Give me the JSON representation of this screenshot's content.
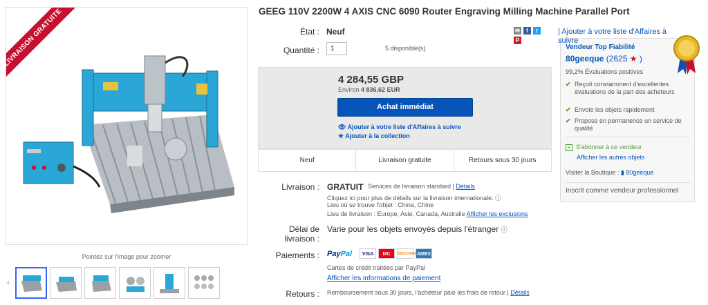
{
  "listing": {
    "title": "GEEG 110V 2200W 4 AXIS CNC 6090 Router Engraving Milling Machine Parallel Port",
    "ribbon": "LIVRAISON GRATUITE",
    "zoom_hint": "Pointez sur l'image pour zoomer",
    "thumb_count": 6
  },
  "item": {
    "condition_label": "État :",
    "condition_value": "Neuf",
    "quantity_label": "Quantité :",
    "quantity_value": "1",
    "available": "5 disponible(s)"
  },
  "price": {
    "amount": "4 284,55 GBP",
    "approx_prefix": "Environ",
    "approx_value": "4 836,62 EUR",
    "buy_label": "Achat immédiat",
    "watch_label": "Ajouter à votre liste d'Affaires à suivre",
    "collection_label": "Ajouter à la collection",
    "strip": [
      "Neuf",
      "Livraison gratuite",
      "Retours sous 30 jours"
    ]
  },
  "shipping": {
    "label": "Livraison :",
    "value": "GRATUIT",
    "service": "Services de livraison standard |",
    "details_link": "Détails",
    "intl_note": "Cliquez ici pour plus de détails sur la livraison internationale.",
    "location": "Lieu où se trouve l'objet : China, Chine",
    "ship_to": "Lieu de livraison : Europe, Asie, Canada, Australie",
    "exclusions_link": "Afficher les exclusions"
  },
  "delivery": {
    "label_1": "Délai de",
    "label_2": "livraison :",
    "value": "Varie pour les objets envoyés depuis l'étranger"
  },
  "payment": {
    "label": "Paiements :",
    "paypal_1": "Pay",
    "paypal_2": "Pal",
    "cards": [
      "VISA",
      "MC",
      "DISCOVER",
      "AMEX"
    ],
    "note": "Cartes de crédit traitées par PayPal",
    "info_link": "Afficher les informations de paiement"
  },
  "returns": {
    "label": "Retours :",
    "value": "Remboursement sous 30 jours, l'acheteur paie les frais de retour |",
    "details_link": "Détails"
  },
  "seller": {
    "wishlist": "| Ajouter à votre liste d'Affaires à suivre",
    "badge_title": "Vendeur Top Fiabilité",
    "name": "80geeque",
    "score": "(2625",
    "score_close": ")",
    "positive": "99,2% Évaluations positives",
    "features": [
      "Reçoit constamment d'excellentes évaluations de la part des acheteurs",
      "Envoie les objets rapidement",
      "Propose en permanence un service de qualité"
    ],
    "follow": "S'abonner à ce vendeur",
    "other_items": "Afficher les autres objets",
    "shop_prefix": "Visiter la Boutique :",
    "shop_name": "80geeque",
    "professional": "Inscrit comme vendeur professionnel"
  },
  "colors": {
    "accent": "#0654ba",
    "ribbon": "#c8102e",
    "check": "#4a9f2d",
    "machine": "#2aa7d6"
  }
}
